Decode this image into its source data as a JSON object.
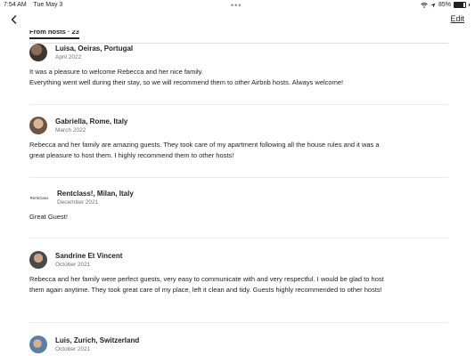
{
  "status_bar": {
    "time": "7:54 AM",
    "date": "Tue May 3",
    "battery": "85%"
  },
  "nav": {
    "edit_label": "Edit"
  },
  "tab": {
    "label": "From hosts · 23"
  },
  "reviews": [
    {
      "name": "Luisa, Oeiras, Portugal",
      "date": "April 2022",
      "lines": [
        "It was a pleasure to welcome Rebecca and her nice family.",
        "Everything went well during their stay, so we will recommend them to other Airbnb hosts. Always welcome!"
      ]
    },
    {
      "name": "Gabriella, Rome, Italy",
      "date": "March 2022",
      "lines": [
        "Rebecca and her family are amazing guests. They took care of my apartment following all the house rules and it was a",
        "great pleasure to host them. I highly recommend them to other hosts!"
      ]
    },
    {
      "name": "Rentclass!, Milan, Italy",
      "date": "December 2021",
      "logo_text": "RentClass",
      "lines": [
        "Great Guest!"
      ]
    },
    {
      "name": "Sandrine Et Vincent",
      "date": "October 2021",
      "lines": [
        "Rebecca and her family were perfect guests, very easy to communicate with and very respectful. I would be glad to host",
        "them again anytime. They took great care of my place, left it clean and tidy. Guests highly recommended to other hosts!"
      ]
    },
    {
      "name": "Luis, Zurich, Switzerland",
      "date": "October 2021",
      "lines": []
    }
  ]
}
